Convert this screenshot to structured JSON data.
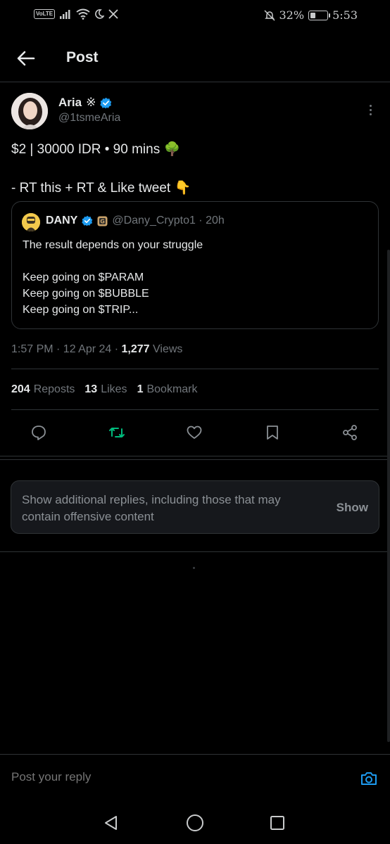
{
  "status_bar": {
    "volte": "VoLTE",
    "battery_text": "32%",
    "battery_level": 0.32,
    "time": "5:53"
  },
  "header": {
    "title": "Post"
  },
  "tweet": {
    "author_name": "Aria",
    "author_symbol": "※",
    "author_handle": "@1tsmeAria",
    "line1": "$2 | 30000 IDR • 90 mins 🌳",
    "line2": "- RT this + RT & Like tweet 👇"
  },
  "quote": {
    "name": "DANY",
    "handle_time": "@Dany_Crypto1 · 20h",
    "lines": [
      "The result depends on your struggle",
      "",
      "Keep going on $PARAM",
      "Keep going on $BUBBLE",
      "Keep going on $TRIP..."
    ]
  },
  "meta": {
    "datetime": "1:57 PM · 12 Apr 24 · ",
    "views_count": "1,277",
    "views_label": " Views"
  },
  "stats": {
    "reposts_count": "204",
    "reposts_label": "Reposts",
    "likes_count": "13",
    "likes_label": "Likes",
    "bookmarks_count": "1",
    "bookmarks_label": "Bookmark"
  },
  "colors": {
    "accent": "#1d9bf0",
    "repost_active": "#00ba7c",
    "muted": "#71767b",
    "background": "#000000"
  },
  "offensive": {
    "text": "Show additional replies, including those that may contain offensive content",
    "button": "Show"
  },
  "reply": {
    "placeholder": "Post your reply"
  }
}
